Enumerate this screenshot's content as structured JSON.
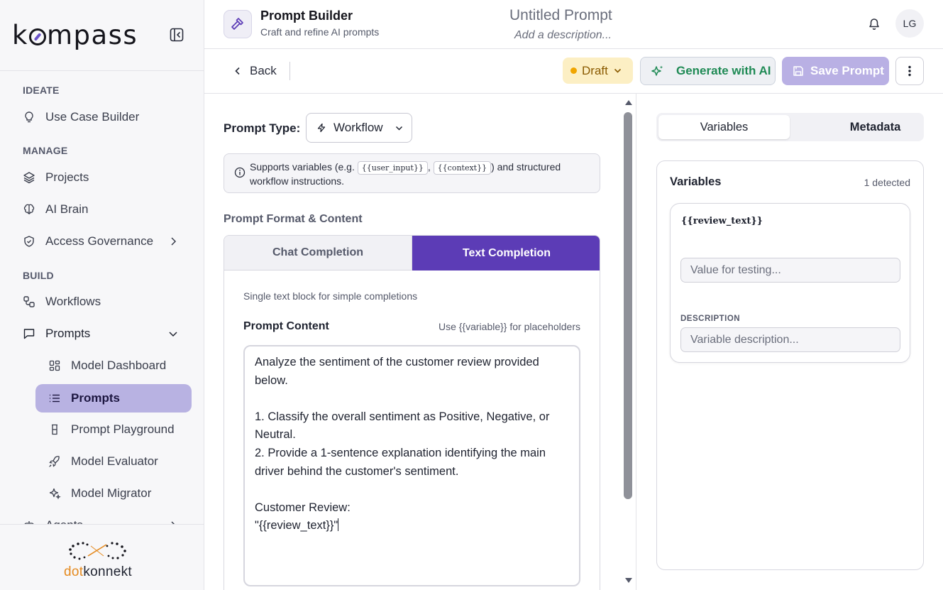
{
  "sidebar": {
    "logo": "kompass",
    "sections": {
      "ideate": "IDEATE",
      "manage": "MANAGE",
      "build": "BUILD"
    },
    "items": {
      "use_case_builder": "Use Case Builder",
      "projects": "Projects",
      "ai_brain": "AI Brain",
      "access_governance": "Access Governance",
      "workflows": "Workflows",
      "prompts": "Prompts",
      "model_dashboard": "Model Dashboard",
      "prompts_sub": "Prompts",
      "prompt_playground": "Prompt Playground",
      "model_evaluator": "Model Evaluator",
      "model_migrator": "Model Migrator",
      "agents": "Agents"
    },
    "footer_brand_dot": "dot",
    "footer_brand_konnekt": "konnekt"
  },
  "header": {
    "app_title": "Prompt Builder",
    "app_subtitle": "Craft and refine AI prompts",
    "doc_title": "Untitled Prompt",
    "doc_description_placeholder": "Add a description...",
    "avatar_initials": "LG"
  },
  "toolbar": {
    "back_label": "Back",
    "status_label": "Draft",
    "generate_label": "Generate with AI",
    "save_label": "Save Prompt"
  },
  "editor": {
    "prompt_type_label": "Prompt Type:",
    "prompt_type_value": "Workflow",
    "info_pre": "Supports variables (e.g. ",
    "info_chip1": "{{user_input}}",
    "info_sep": ", ",
    "info_chip2": "{{context}}",
    "info_post": ") and structured workflow instructions.",
    "section_heading": "Prompt Format & Content",
    "tab_chat": "Chat Completion",
    "tab_text": "Text Completion",
    "format_description": "Single text block for simple completions",
    "content_label": "Prompt Content",
    "content_hint": "Use {{variable}} for placeholders",
    "content_value": "Analyze the sentiment of the customer review provided\nbelow.\n\n1. Classify the overall sentiment as Positive, Negative, or\nNeutral.\n2. Provide a 1-sentence explanation identifying the main\ndriver behind the customer's sentiment.\n\nCustomer Review:\n\"{{review_text}}\""
  },
  "right_panel": {
    "tab_variables": "Variables",
    "tab_metadata": "Metadata",
    "panel_title": "Variables",
    "detected_count": "1 detected",
    "variables": [
      {
        "name": "{{review_text}}",
        "value_placeholder": "Value for testing...",
        "description_label": "DESCRIPTION",
        "description_placeholder": "Variable description..."
      }
    ]
  },
  "colors": {
    "accent": "#5c3cb6",
    "accent_light": "#b8b2e2",
    "draft_bg": "#fcefc4",
    "draft_dot": "#f0a500",
    "generate_text": "#1f8a55"
  }
}
